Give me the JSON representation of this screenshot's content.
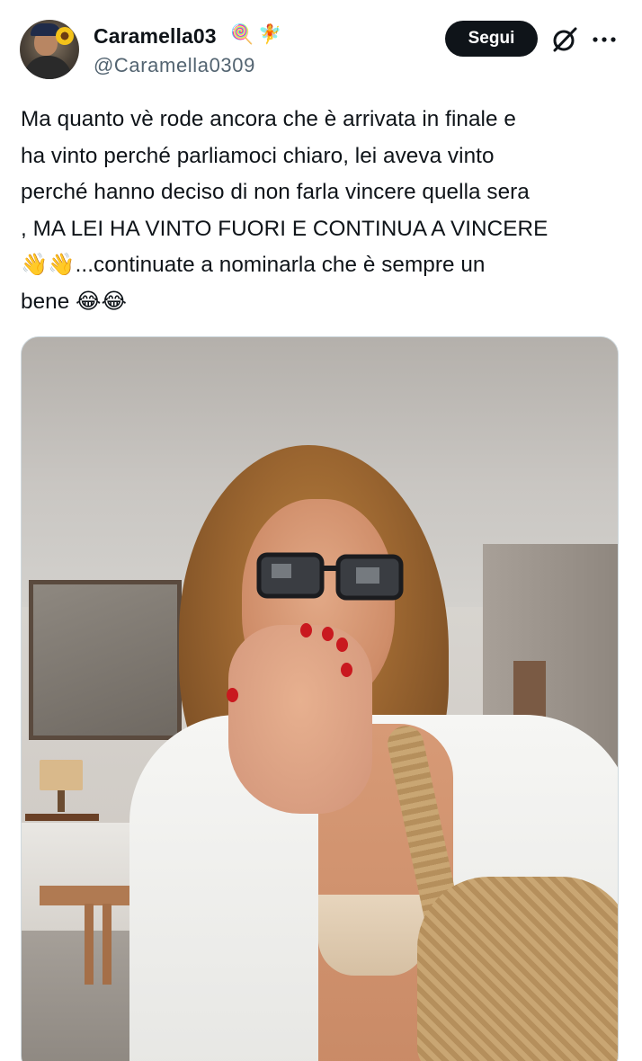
{
  "author": {
    "display_name": "Caramella03",
    "name_emojis": [
      "🍭",
      "🧚"
    ],
    "handle": "@Caramella0309"
  },
  "actions": {
    "follow_label": "Segui"
  },
  "icons": {
    "grok": "grok-icon",
    "more": "more-icon"
  },
  "tweet": {
    "lines": [
      "Ma quanto vè rode ancora che è arrivata in finale e",
      "ha vinto perché parliamoci chiaro, lei aveva vinto",
      "perché hanno deciso di non farla vincere quella sera",
      ", MA  LEI HA VINTO FUORI E CONTINUA A VINCERE",
      "👋👋...continuate a nominarla che è sempre un",
      "bene 😂😂"
    ]
  },
  "colors": {
    "text": "#0f1419",
    "secondary": "#536471",
    "button_bg": "#0f1419",
    "button_text": "#ffffff"
  }
}
